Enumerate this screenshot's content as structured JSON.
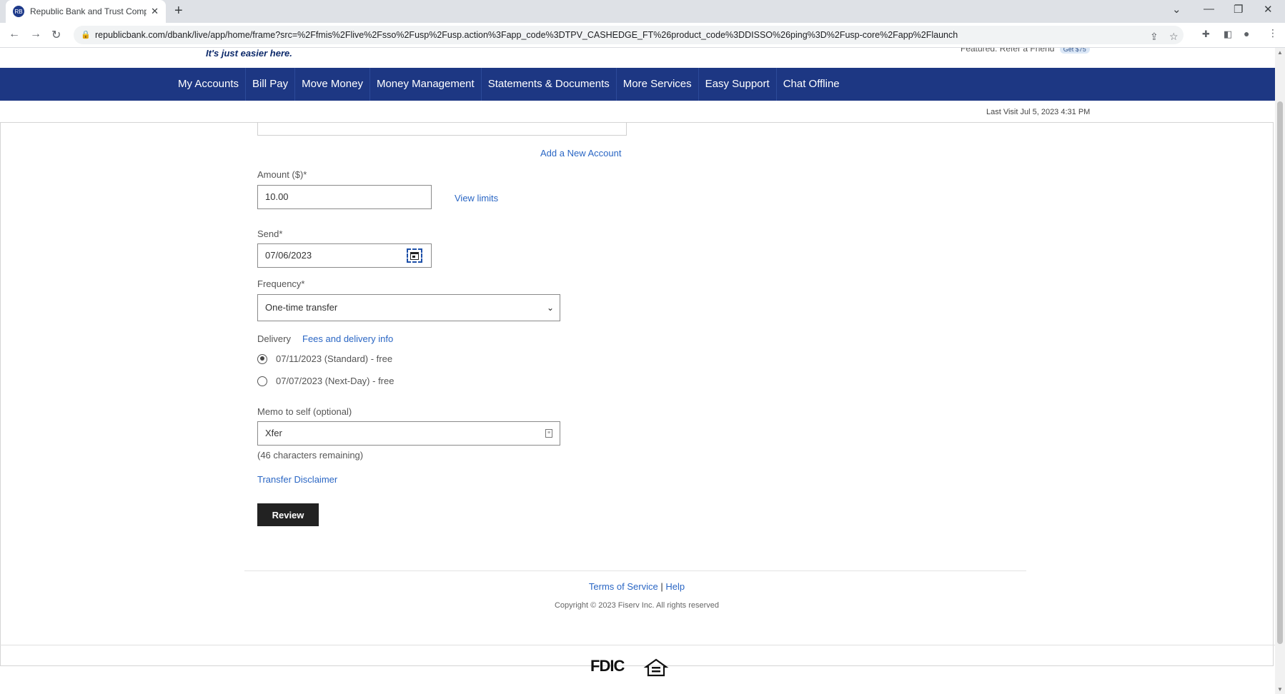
{
  "browser": {
    "tab_title": "Republic Bank and Trust Compar",
    "tab_favicon_text": "RB",
    "new_tab_symbol": "+",
    "close_symbol": "✕",
    "url": "republicbank.com/dbank/live/app/home/frame?src=%2Ffmis%2Flive%2Fsso%2Fusp%2Fusp.action%3Fapp_code%3DTPV_CASHEDGE_FT%26product_code%3DDISSO%26ping%3D%2Fusp-core%2Fapp%2Flaunch"
  },
  "header": {
    "tagline": "It's just easier here.",
    "featured_label": "Featured:",
    "featured_link": "Refer a Friend",
    "featured_badge": "Get $75"
  },
  "nav": {
    "items": [
      "My Accounts",
      "Bill Pay",
      "Move Money",
      "Money Management",
      "Statements & Documents",
      "More Services",
      "Easy Support",
      "Chat Offline"
    ]
  },
  "last_visit": "Last Visit Jul 5, 2023 4:31 PM",
  "form": {
    "add_account_link": "Add a New Account",
    "amount_label": "Amount ($)*",
    "amount_value": "10.00",
    "view_limits_link": "View limits",
    "send_label": "Send*",
    "send_value": "07/06/2023",
    "frequency_label": "Frequency*",
    "frequency_value": "One-time transfer",
    "delivery_label": "Delivery",
    "fees_link": "Fees and delivery info",
    "delivery_options": [
      {
        "label": "07/11/2023 (Standard) - free",
        "selected": true
      },
      {
        "label": "07/07/2023 (Next-Day) - free",
        "selected": false
      }
    ],
    "memo_label": "Memo to self (optional)",
    "memo_value": "Xfer",
    "memo_remaining": "(46 characters remaining)",
    "disclaimer_link": "Transfer Disclaimer",
    "review_button": "Review"
  },
  "footer": {
    "terms_link": "Terms of Service",
    "separator": "|",
    "help_link": "Help",
    "copyright": "Copyright © 2023 Fiserv Inc. All rights reserved",
    "fdic_logo": "FDIC",
    "ehl_logo_text": "EQUAL HOUSING LENDER"
  },
  "colors": {
    "nav_background": "#1d3783",
    "link": "#2a66c4",
    "button": "#222222"
  }
}
